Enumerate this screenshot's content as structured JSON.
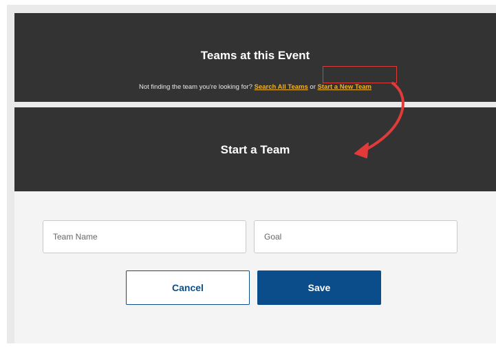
{
  "teams_panel": {
    "title": "Teams at this Event",
    "prompt": "Not finding the team you're looking for?",
    "search_link": "Search All Teams",
    "connector": "or",
    "start_link": "Start a New Team"
  },
  "start_panel": {
    "title": "Start a Team"
  },
  "form": {
    "team_name_placeholder": "Team Name",
    "goal_placeholder": "Goal",
    "cancel_label": "Cancel",
    "save_label": "Save"
  },
  "colors": {
    "dark_panel": "#333333",
    "link_gold": "#f0b323",
    "primary_blue": "#0b4d8a",
    "annotation_red": "#e03a3a"
  }
}
